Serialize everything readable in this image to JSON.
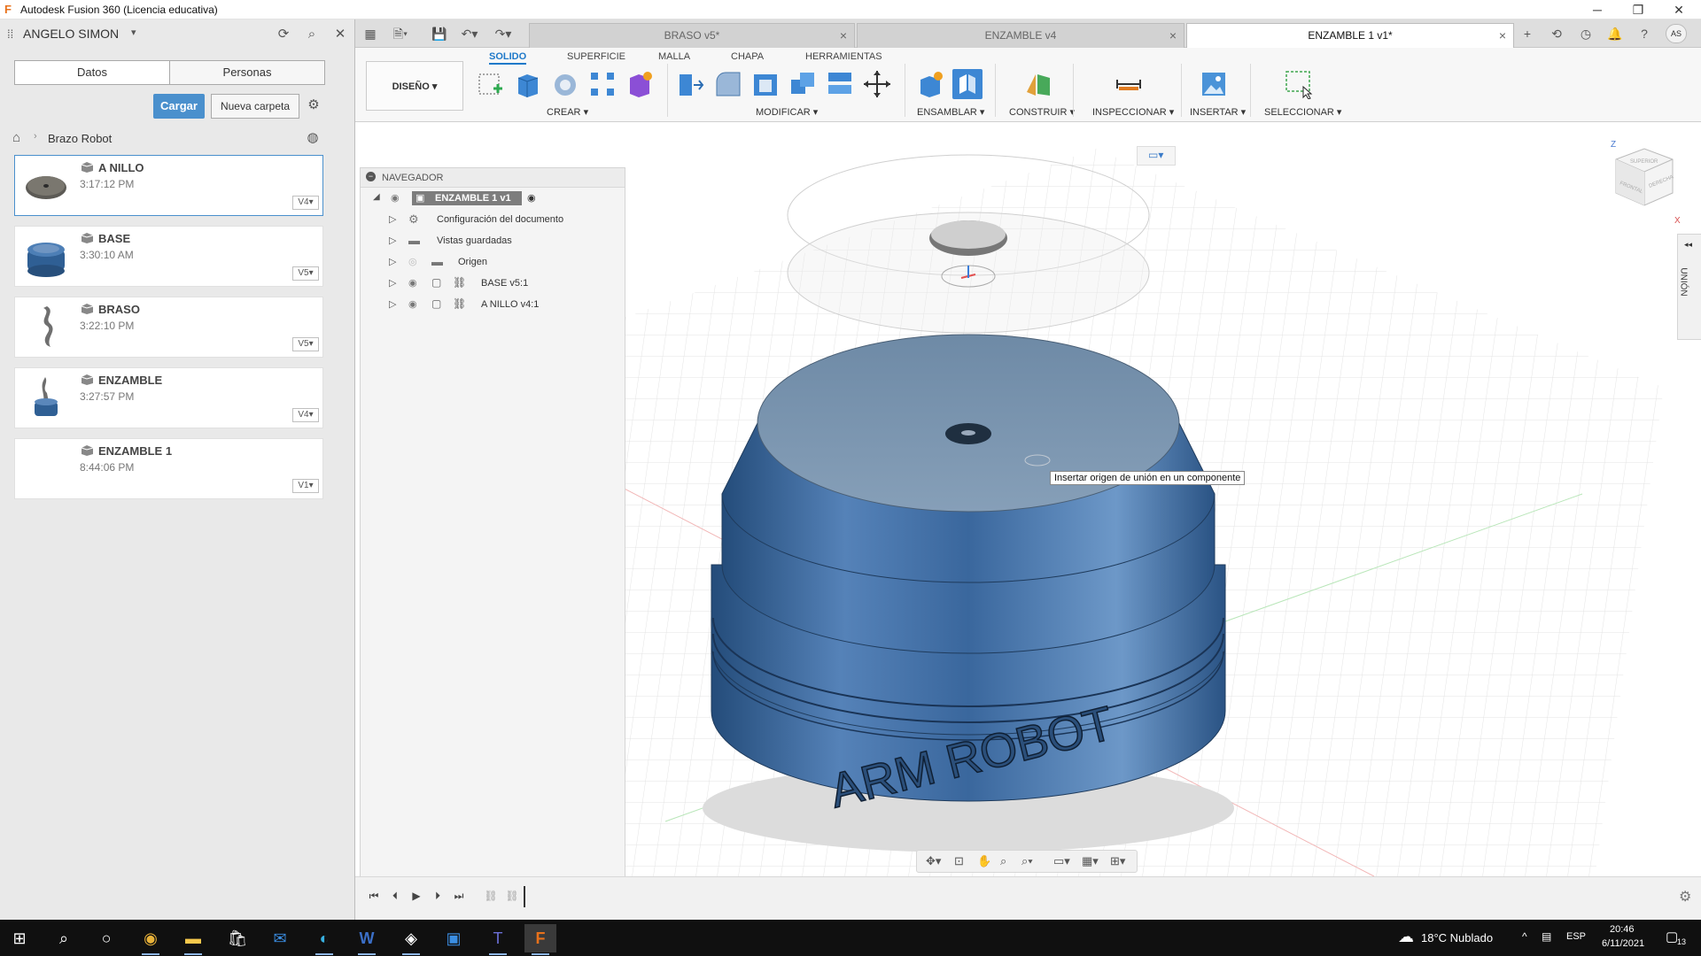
{
  "window": {
    "title": "Autodesk Fusion 360 (Licencia educativa)",
    "logo": "F"
  },
  "data_panel": {
    "user": "ANGELO SIMON",
    "segments": [
      "Datos",
      "Personas"
    ],
    "upload_label": "Cargar",
    "new_folder_label": "Nueva carpeta",
    "breadcrumb": "Brazo Robot",
    "files": [
      {
        "name": "A NILLO",
        "time": "3:17:12 PM",
        "version": "V4"
      },
      {
        "name": "BASE",
        "time": "3:30:10 AM",
        "version": "V5"
      },
      {
        "name": "BRASO",
        "time": "3:22:10 PM",
        "version": "V5"
      },
      {
        "name": "ENZAMBLE",
        "time": "3:27:57 PM",
        "version": "V4"
      },
      {
        "name": "ENZAMBLE 1",
        "time": "8:44:06 PM",
        "version": "V1"
      }
    ]
  },
  "tabs": [
    {
      "label": "BRASO v5*"
    },
    {
      "label": "ENZAMBLE v4"
    },
    {
      "label": "ENZAMBLE 1 v1*"
    }
  ],
  "ribbon": {
    "tabs": [
      "SOLIDO",
      "SUPERFICIE",
      "MALLA",
      "CHAPA",
      "HERRAMIENTAS"
    ],
    "workspace": "DISEÑO",
    "groups": [
      "CREAR",
      "MODIFICAR",
      "ENSAMBLAR",
      "CONSTRUIR",
      "INSPECCIONAR",
      "INSERTAR",
      "SELECCIONAR"
    ]
  },
  "navigator": {
    "title": "NAVEGADOR",
    "root": "ENZAMBLE 1 v1",
    "items": [
      {
        "label": "Configuración del documento"
      },
      {
        "label": "Vistas guardadas"
      },
      {
        "label": "Origen"
      },
      {
        "label": "BASE v5:1"
      },
      {
        "label": "A NILLO v4:1"
      }
    ]
  },
  "viewport": {
    "tooltip": "Insertar origen de unión en un componente",
    "model_text": "ARM ROBOT",
    "viewcube_labels": {
      "z": "Z",
      "x": "X",
      "right": "DERECHA",
      "front": "FRONTAL",
      "top": "SUPERIOR"
    },
    "side_panel_label": "UNIÓN"
  },
  "taskbar": {
    "weather": "18°C  Nublado",
    "language": "ESP",
    "time": "20:46",
    "date": "6/11/2021",
    "notifications": "13"
  },
  "colors": {
    "accent": "#1f79c9",
    "model_blue": "#3f70a7",
    "button_blue": "#4a90cd"
  }
}
